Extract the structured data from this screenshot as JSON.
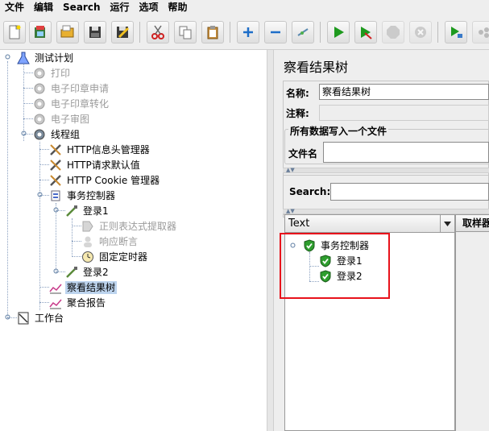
{
  "menu": [
    "文件",
    "编辑",
    "Search",
    "运行",
    "选项",
    "帮助"
  ],
  "toolbar": {
    "icons": [
      "new-icon",
      "templates-icon",
      "open-icon",
      "save-icon",
      "save-as-icon",
      "cut-icon",
      "copy-icon",
      "paste-icon",
      "expand-icon",
      "collapse-icon",
      "toggle-icon",
      "start-icon",
      "start-no-pause-icon",
      "stop-icon",
      "shutdown-icon",
      "remote-start-icon",
      "remote-start-all-icon"
    ]
  },
  "tree": {
    "test_plan": "测试计划",
    "print": "打印",
    "seal_apply": "电子印章申请",
    "seal_convert": "电子印章转化",
    "seal_review": "电子审图",
    "thread_group": "线程组",
    "http_header": "HTTP信息头管理器",
    "http_defaults": "HTTP请求默认值",
    "cookie_manager": "HTTP Cookie 管理器",
    "transaction": "事务控制器",
    "login1": "登录1",
    "regex": "正则表达式提取器",
    "assertion": "响应断言",
    "timer": "固定定时器",
    "login2": "登录2",
    "view_results": "察看结果树",
    "aggregate": "聚合报告",
    "workbench": "工作台"
  },
  "panel": {
    "title": "察看结果树",
    "name_label": "名称:",
    "name_value": "察看结果树",
    "comment_label": "注释:",
    "file_group": "所有数据写入一个文件",
    "file_label": "文件名",
    "search_label": "Search:",
    "renderer": "Text",
    "tab_label": "取样器",
    "results": [
      "事务控制器",
      "登录1",
      "登录2"
    ]
  },
  "colors": {
    "highlight": "#e8121b",
    "selection": "#bdd4ee",
    "success": "#2e9e2e"
  }
}
